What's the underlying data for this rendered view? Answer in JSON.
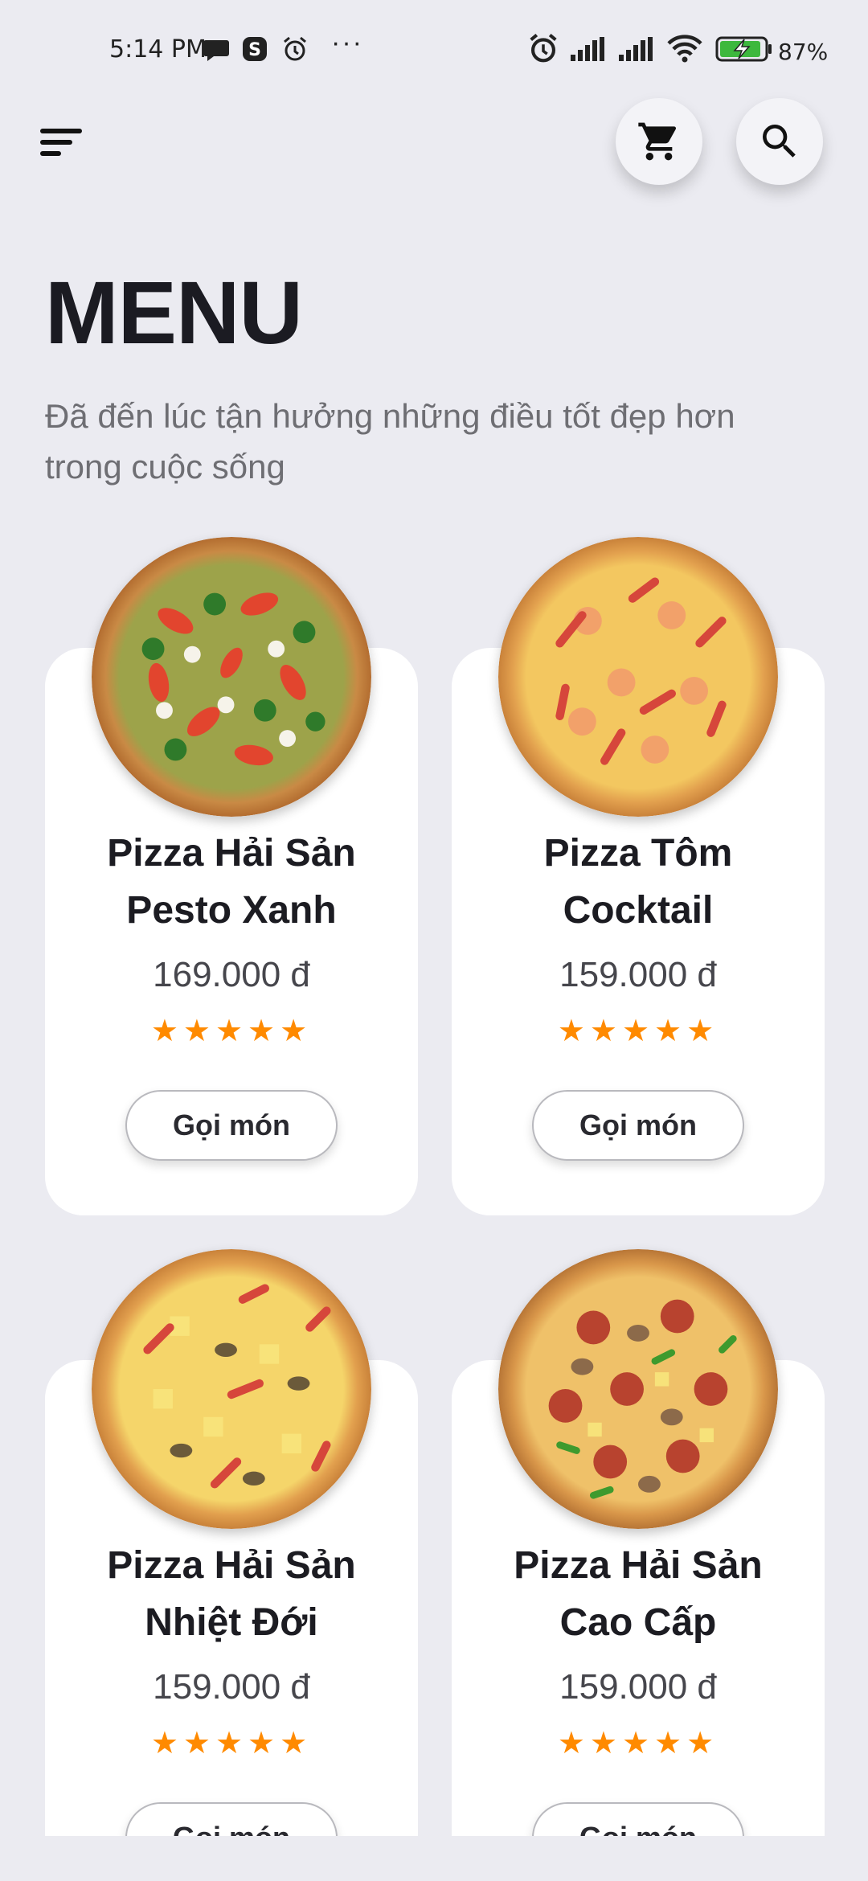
{
  "status_bar": {
    "time": "5:14 PM",
    "icons": [
      "chat-icon",
      "skype-icon",
      "alarm-icon",
      "more-dots-icon",
      "alarm-icon",
      "signal-icon",
      "signal-icon",
      "wifi-icon",
      "battery-charging-icon"
    ],
    "dots": "···",
    "battery": "87%"
  },
  "header": {
    "menu_icon": "menu-lines-icon",
    "cart_icon": "cart-icon",
    "search_icon": "search-icon"
  },
  "page": {
    "title": "MENU",
    "subtitle": "Đã đến lúc tận hưởng những điều tốt đẹp hơn trong cuộc sống"
  },
  "products": [
    {
      "name_line1": "Pizza Hải Sản",
      "name_line2": "Pesto Xanh",
      "price": "169.000 đ",
      "rating": 5,
      "stars": "★★★★★",
      "button": "Gọi món"
    },
    {
      "name_line1": "Pizza Tôm",
      "name_line2": "Cocktail",
      "price": "159.000 đ",
      "rating": 5,
      "stars": "★★★★★",
      "button": "Gọi món"
    },
    {
      "name_line1": "Pizza Hải Sản",
      "name_line2": "Nhiệt Đới",
      "price": "159.000 đ",
      "rating": 5,
      "stars": "★★★★★",
      "button": "Gọi món"
    },
    {
      "name_line1": "Pizza Hải Sản",
      "name_line2": "Cao Cấp",
      "price": "159.000 đ",
      "rating": 5,
      "stars": "★★★★★",
      "button": "Gọi món"
    }
  ],
  "colors": {
    "background": "#EBEBF1",
    "card": "#FFFFFF",
    "star": "#FF8A00",
    "title": "#1B1B22",
    "battery_green": "#3DB83D"
  }
}
